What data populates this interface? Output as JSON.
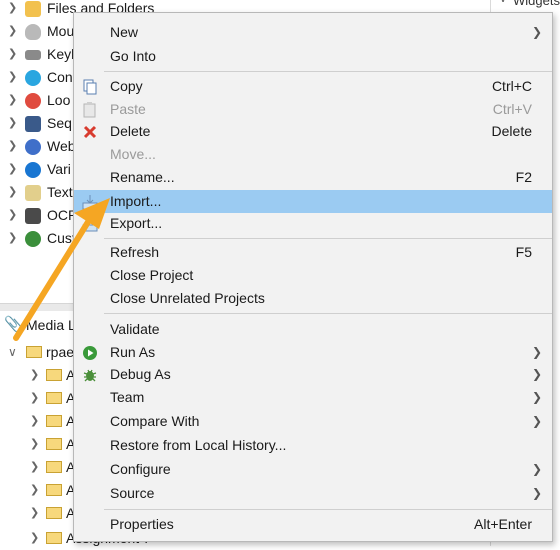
{
  "tree": [
    {
      "label": "Files and Folders",
      "icon": "folder-icon",
      "color": "#f2c14e"
    },
    {
      "label": "Mou",
      "icon": "mouse-icon",
      "color": "#8c8c8c"
    },
    {
      "label": "Keyl",
      "icon": "keyboard-icon",
      "color": "#6d6d6d"
    },
    {
      "label": "Con",
      "icon": "connector-icon",
      "color": "#2aa6e0"
    },
    {
      "label": "Loo",
      "icon": "loop-icon",
      "color": "#e04b3f"
    },
    {
      "label": "Seq",
      "icon": "sequence-icon",
      "color": "#3a5a8a"
    },
    {
      "label": "Web",
      "icon": "globe-icon",
      "color": "#3f6fc9"
    },
    {
      "label": "Vari",
      "icon": "variable-icon",
      "color": "#1976d2"
    },
    {
      "label": "Text",
      "icon": "text-icon",
      "color": "#c9a44b"
    },
    {
      "label": "OCR",
      "icon": "ocr-icon",
      "color": "#4a4a4a"
    },
    {
      "label": "Cust",
      "icon": "custom-icon",
      "color": "#3b8f3b"
    }
  ],
  "media": {
    "label": "Media L"
  },
  "project": {
    "label": "rpae"
  },
  "subfolders": [
    "A",
    "A",
    "A",
    "A",
    "A",
    "A",
    "A"
  ],
  "last_subfolder": "Assignment 7",
  "right_pane": {
    "label": "Widgets"
  },
  "menu": {
    "new": "New",
    "go_into": "Go Into",
    "copy": "Copy",
    "copy_sc": "Ctrl+C",
    "paste": "Paste",
    "paste_sc": "Ctrl+V",
    "delete": "Delete",
    "delete_sc": "Delete",
    "move": "Move...",
    "rename": "Rename...",
    "rename_sc": "F2",
    "import": "Import...",
    "export": "Export...",
    "refresh": "Refresh",
    "refresh_sc": "F5",
    "close_project": "Close Project",
    "close_unrelated": "Close Unrelated Projects",
    "validate": "Validate",
    "run_as": "Run As",
    "debug_as": "Debug As",
    "team": "Team",
    "compare_with": "Compare With",
    "restore": "Restore from Local History...",
    "configure": "Configure",
    "source": "Source",
    "properties": "Properties",
    "properties_sc": "Alt+Enter"
  },
  "colors": {
    "highlight": "#9bcbf2",
    "arrow": "#f5a623",
    "menu_bg": "#f2f2f2"
  }
}
